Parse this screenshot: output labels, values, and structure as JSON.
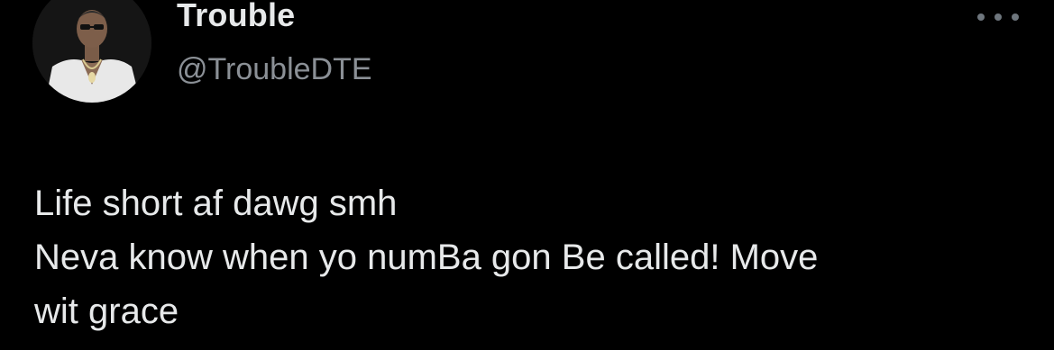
{
  "author": {
    "display_name": "Trouble",
    "handle": "@TroubleDTE",
    "avatar_icon": "profile-photo"
  },
  "header": {
    "more_icon": "more-options-icon"
  },
  "tweet": {
    "lines": [
      "Life short af dawg smh",
      "Neva know when yo numBa gon Be called! Move",
      "wit grace"
    ]
  },
  "colors": {
    "background": "#000000",
    "text": "#e7e9ea",
    "secondary_text": "#8b9096"
  }
}
